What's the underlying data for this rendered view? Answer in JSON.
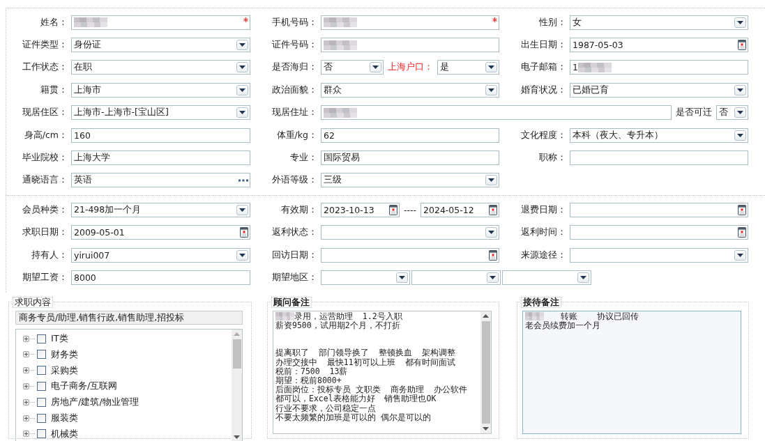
{
  "sections": [
    {
      "rows": [
        {
          "cells": [
            {
              "label": "姓名：",
              "parts": [
                {
                  "kind": "text",
                  "redacted": true,
                  "required": true
                }
              ]
            },
            {
              "label": "手机号码：",
              "parts": [
                {
                  "kind": "text",
                  "redacted": true,
                  "required": true
                }
              ]
            },
            {
              "label": "性别：",
              "parts": [
                {
                  "kind": "select",
                  "value": "女"
                }
              ]
            }
          ]
        },
        {
          "cells": [
            {
              "label": "证件类型：",
              "parts": [
                {
                  "kind": "select",
                  "value": "身份证"
                }
              ]
            },
            {
              "label": "证件号码：",
              "parts": [
                {
                  "kind": "text",
                  "redacted": true
                }
              ]
            },
            {
              "label": "出生日期：",
              "parts": [
                {
                  "kind": "date",
                  "value": "1987-05-03"
                }
              ]
            }
          ]
        },
        {
          "cells": [
            {
              "label": "工作状态：",
              "parts": [
                {
                  "kind": "select",
                  "value": "在职"
                }
              ]
            },
            {
              "label": "是否海归：",
              "parts": [
                {
                  "kind": "select",
                  "value": "否"
                },
                {
                  "kind": "label",
                  "text": "上海户口：",
                  "emphasis": true
                },
                {
                  "kind": "select",
                  "value": "是"
                }
              ]
            },
            {
              "label": "电子邮箱：",
              "parts": [
                {
                  "kind": "text",
                  "value": "1",
                  "redacted": true
                }
              ]
            }
          ]
        },
        {
          "cells": [
            {
              "label": "籍贯：",
              "parts": [
                {
                  "kind": "select",
                  "value": "上海市"
                }
              ]
            },
            {
              "label": "政治面貌：",
              "parts": [
                {
                  "kind": "select",
                  "value": "群众"
                }
              ]
            },
            {
              "label": "婚育状况：",
              "parts": [
                {
                  "kind": "select",
                  "value": "已婚已育"
                }
              ]
            }
          ]
        },
        {
          "cells": [
            {
              "label": "现居住区：",
              "parts": [
                {
                  "kind": "select",
                  "value": "上海市-上海市-[宝山区]"
                }
              ]
            },
            {
              "label": "现居住址：",
              "wide": true,
              "parts": [
                {
                  "kind": "text",
                  "redacted": true
                },
                {
                  "kind": "label",
                  "text": "是否可迁",
                  "emphasis": false
                },
                {
                  "kind": "select",
                  "value": "否"
                }
              ]
            }
          ]
        },
        {
          "cells": [
            {
              "label": "身高/cm：",
              "parts": [
                {
                  "kind": "text",
                  "value": "160"
                }
              ]
            },
            {
              "label": "体重/kg：",
              "parts": [
                {
                  "kind": "text",
                  "value": "62"
                }
              ]
            },
            {
              "label": "文化程度：",
              "parts": [
                {
                  "kind": "select",
                  "value": "本科（夜大、专升本）"
                }
              ]
            }
          ]
        },
        {
          "cells": [
            {
              "label": "毕业院校：",
              "parts": [
                {
                  "kind": "text",
                  "value": "上海大学"
                }
              ]
            },
            {
              "label": "专业：",
              "parts": [
                {
                  "kind": "text",
                  "value": "国际贸易"
                }
              ]
            },
            {
              "label": "职称：",
              "parts": [
                {
                  "kind": "text"
                }
              ]
            }
          ]
        },
        {
          "cells": [
            {
              "label": "通晓语言：",
              "parts": [
                {
                  "kind": "picker",
                  "value": "英语"
                }
              ]
            },
            {
              "label": "外语等级：",
              "parts": [
                {
                  "kind": "select",
                  "value": "三级"
                }
              ]
            }
          ]
        }
      ]
    },
    {
      "rows": [
        {
          "cells": [
            {
              "label": "会员种类：",
              "parts": [
                {
                  "kind": "select",
                  "value": "21-498加一个月"
                }
              ]
            },
            {
              "label": "有效期：",
              "parts": [
                {
                  "kind": "date",
                  "value": "2023-10-13"
                },
                {
                  "kind": "label",
                  "text": "----",
                  "emphasis": false
                },
                {
                  "kind": "date",
                  "value": "2024-05-12"
                }
              ]
            },
            {
              "label": "退费日期：",
              "parts": [
                {
                  "kind": "date"
                }
              ]
            }
          ]
        },
        {
          "cells": [
            {
              "label": "求职日期：",
              "parts": [
                {
                  "kind": "date",
                  "value": "2009-05-01"
                }
              ]
            },
            {
              "label": "返利状态：",
              "parts": [
                {
                  "kind": "select"
                }
              ]
            },
            {
              "label": "返利时间：",
              "parts": [
                {
                  "kind": "date"
                }
              ]
            }
          ]
        },
        {
          "cells": [
            {
              "label": "持有人：",
              "parts": [
                {
                  "kind": "select",
                  "value": "yirui007"
                }
              ]
            },
            {
              "label": "回访日期：",
              "parts": [
                {
                  "kind": "date"
                }
              ]
            },
            {
              "label": "来源途径：",
              "parts": [
                {
                  "kind": "select"
                }
              ]
            }
          ]
        },
        {
          "cells": [
            {
              "label": "期望工资：",
              "parts": [
                {
                  "kind": "text",
                  "value": "8000"
                }
              ]
            },
            {
              "label": "期望地区：",
              "parts": [
                {
                  "kind": "select"
                },
                {
                  "kind": "select"
                },
                {
                  "kind": "select"
                }
              ]
            }
          ]
        }
      ]
    }
  ],
  "job_panel": {
    "title": "求职内容",
    "emphasis": false,
    "summary": "商务专员/助理,销售行政,销售助理,招投标",
    "tree": [
      {
        "label": "IT类",
        "checked": false,
        "expanded": false
      },
      {
        "label": "财务类",
        "checked": false,
        "expanded": false
      },
      {
        "label": "采购类",
        "checked": false,
        "expanded": false
      },
      {
        "label": "电子商务/互联网",
        "checked": false,
        "expanded": false
      },
      {
        "label": "房地产/建筑/物业管理",
        "checked": false,
        "expanded": false
      },
      {
        "label": "服装类",
        "checked": false,
        "expanded": false
      },
      {
        "label": "机械类",
        "checked": false,
        "expanded": false
      }
    ]
  },
  "notes": [
    {
      "title": "顾问备注",
      "emphasis": true,
      "focused": false,
      "paragraphs": [
        {
          "lines": [
            {
              "text": "录用，运营助理  1.2号入职",
              "redacted_prefix": true
            },
            {
              "text": "薪资9500，试用期2个月，不打折",
              "redacted_prefix": false
            }
          ]
        },
        {
          "lines": [
            {
              "text": "提离职了  部门领导换了  整顿换血  架构调整",
              "redacted_prefix": false
            },
            {
              "text": "办理交接中  最快11初可以上班  都有时间面试",
              "redacted_prefix": false
            },
            {
              "text": "税前：7500  13薪",
              "redacted_prefix": false
            },
            {
              "text": "期望：税前8000+",
              "redacted_prefix": false
            },
            {
              "text": "后面岗位：投标专员 文职类  商务助理  办公软件",
              "redacted_prefix": false
            },
            {
              "text": "都可以，Excel表格能力好  销售助理也OK",
              "redacted_prefix": false
            },
            {
              "text": "行业不要求，公司稳定一点",
              "redacted_prefix": false
            },
            {
              "text": "不要太频繁的加班是可以的 偶尔是可以的",
              "redacted_prefix": false
            }
          ]
        }
      ]
    },
    {
      "title": "接待备注",
      "emphasis": true,
      "focused": true,
      "paragraphs": [
        {
          "lines": [
            {
              "text": "转账    协议已回传",
              "redacted_prefix": true
            },
            {
              "text": "老会员续费加一个月",
              "redacted_prefix": false
            }
          ]
        }
      ]
    }
  ]
}
